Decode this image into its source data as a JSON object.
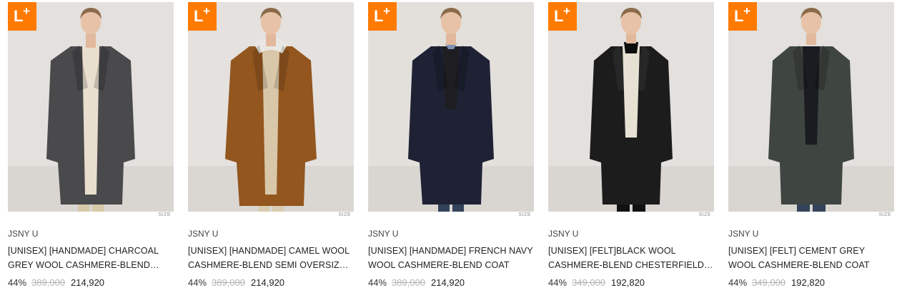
{
  "badge": {
    "letter": "L",
    "plus": "+"
  },
  "size_tag": "SIZE",
  "products": [
    {
      "brand": "JSNY U",
      "title": "[UNISEX] [HANDMADE] CHARCOAL GREY WOOL CASHMERE-BLEND LONG COAT",
      "discount": "44%",
      "original_price": "389,000",
      "sale_price": "214,920",
      "coat_color": "#4a4a4c",
      "inner_color": "#e9dfcf"
    },
    {
      "brand": "JSNY U",
      "title": "[UNISEX] [HANDMADE] CAMEL WOOL CASHMERE-BLEND SEMI OVERSIZED COAT",
      "discount": "44%",
      "original_price": "389,000",
      "sale_price": "214,920",
      "coat_color": "#93561f",
      "inner_color": "#d9c7a9"
    },
    {
      "brand": "JSNY U",
      "title": "[UNISEX] [HANDMADE] FRENCH NAVY WOOL CASHMERE-BLEND COAT",
      "discount": "44%",
      "original_price": "389,000",
      "sale_price": "214,920",
      "coat_color": "#1f2235",
      "inner_color": "#1e1e22"
    },
    {
      "brand": "JSNY U",
      "title": "[UNISEX] [FELT]BLACK WOOL CASHMERE-BLEND CHESTERFIELD COAT",
      "discount": "44%",
      "original_price": "349,000",
      "sale_price": "192,820",
      "coat_color": "#1c1c1c",
      "inner_color": "#e7e1d4"
    },
    {
      "brand": "JSNY U",
      "title": "[UNISEX] [FELT] CEMENT GREY WOOL CASHMERE-BLEND COAT",
      "discount": "44%",
      "original_price": "349,000",
      "sale_price": "192,820",
      "coat_color": "#3f4540",
      "inner_color": "#1a1c22"
    }
  ]
}
